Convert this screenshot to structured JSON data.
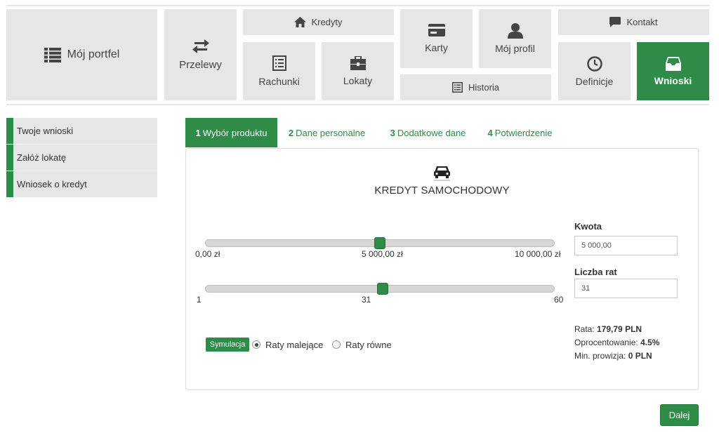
{
  "nav": {
    "portfolio": {
      "label": "Mój portfel",
      "icon": "list-icon"
    },
    "transfers": {
      "label": "Przelewy",
      "icon": "transfer-arrows-icon"
    },
    "credits": {
      "label": "Kredyty",
      "icon": "home-icon"
    },
    "accounts": {
      "label": "Rachunki",
      "icon": "ledger-icon"
    },
    "deposits": {
      "label": "Lokaty",
      "icon": "briefcase-icon"
    },
    "cards": {
      "label": "Karty",
      "icon": "credit-card-icon"
    },
    "profile": {
      "label": "Mój profil",
      "icon": "user-icon"
    },
    "history": {
      "label": "Historia",
      "icon": "list-alt-icon"
    },
    "contact": {
      "label": "Kontakt",
      "icon": "comment-icon"
    },
    "definitions": {
      "label": "Definicje",
      "icon": "clock-icon"
    },
    "applications": {
      "label": "Wnioski",
      "icon": "inbox-icon",
      "active": true
    }
  },
  "sidebar": {
    "items": [
      {
        "label": "Twoje wnioski"
      },
      {
        "label": "Załóż lokatę"
      },
      {
        "label": "Wniosek o kredyt"
      }
    ]
  },
  "steps": [
    {
      "num": "1",
      "label": "Wybór produktu",
      "active": true
    },
    {
      "num": "2",
      "label": "Dane personalne",
      "active": false
    },
    {
      "num": "3",
      "label": "Dodatkowe dane",
      "active": false
    },
    {
      "num": "4",
      "label": "Potwierdzenie",
      "active": false
    }
  ],
  "product": {
    "title": "KREDYT SAMOCHODOWY",
    "icon": "car-icon"
  },
  "amount_slider": {
    "min_label": "0,00 zł",
    "mid_label": "5 000,00 zł",
    "max_label": "10 000,00 zł",
    "min": 0,
    "max": 10000,
    "value": 5000
  },
  "installments_slider": {
    "min_label": "1",
    "mid_label": "31",
    "max_label": "60",
    "min": 1,
    "max": 60,
    "value": 31
  },
  "form": {
    "amount_label": "Kwota",
    "amount_value": "5 000,00",
    "installments_label": "Liczba rat",
    "installments_value": "31"
  },
  "simulation": {
    "button_label": "Symulacja",
    "option_decreasing": "Raty malejące",
    "option_equal": "Raty równe",
    "selected": "decreasing"
  },
  "summary": {
    "rate_label": "Rata:",
    "rate_value": "179,79 PLN",
    "interest_label": "Oprocentowanie:",
    "interest_value": "4.5%",
    "commission_label": "Min. prowizja:",
    "commission_value": "0 PLN"
  },
  "next_button": "Dalej",
  "colors": {
    "accent": "#2e8b48",
    "tile_bg": "#e6e6e6"
  }
}
